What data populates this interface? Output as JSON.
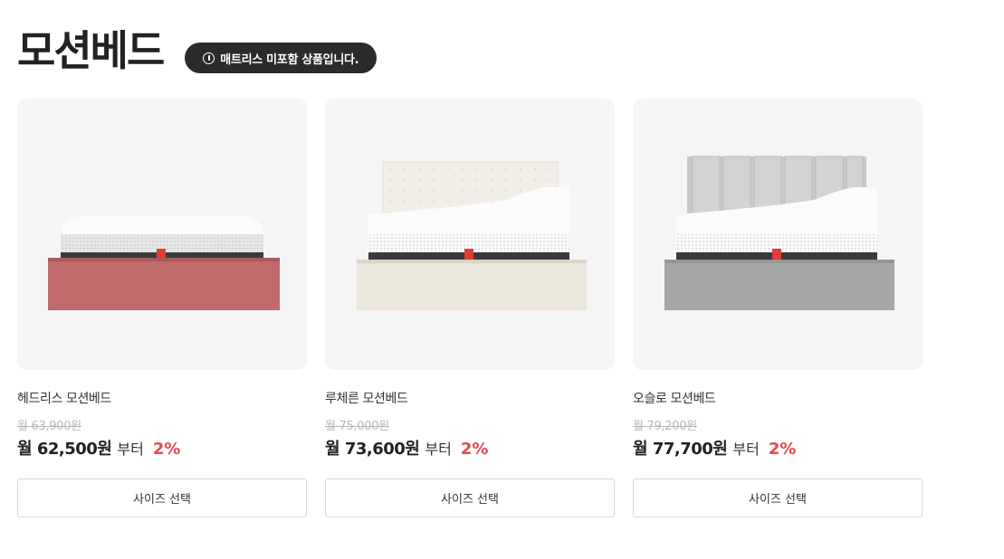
{
  "header": {
    "title": "모션베드",
    "notice": "매트리스 미포함 상품입니다."
  },
  "products": [
    {
      "name": "헤드리스 모션베드",
      "original_price": "월 63,900원",
      "price": "월 62,500원",
      "price_suffix": "부터",
      "discount": "2%",
      "button_label": "사이즈 선택",
      "frame_color": "#c06a6c"
    },
    {
      "name": "루체른 모션베드",
      "original_price": "월 75,000원",
      "price": "월 73,600원",
      "price_suffix": "부터",
      "discount": "2%",
      "button_label": "사이즈 선택",
      "frame_color": "#ebe7dc"
    },
    {
      "name": "오슬로 모션베드",
      "original_price": "월 79,200원",
      "price": "월 77,700원",
      "price_suffix": "부터",
      "discount": "2%",
      "button_label": "사이즈 선택",
      "frame_color": "#a7a7a7"
    }
  ],
  "colors": {
    "accent_discount": "#e5484d",
    "badge_bg": "#2b2b2b",
    "mattress_tag": "#e53935"
  }
}
